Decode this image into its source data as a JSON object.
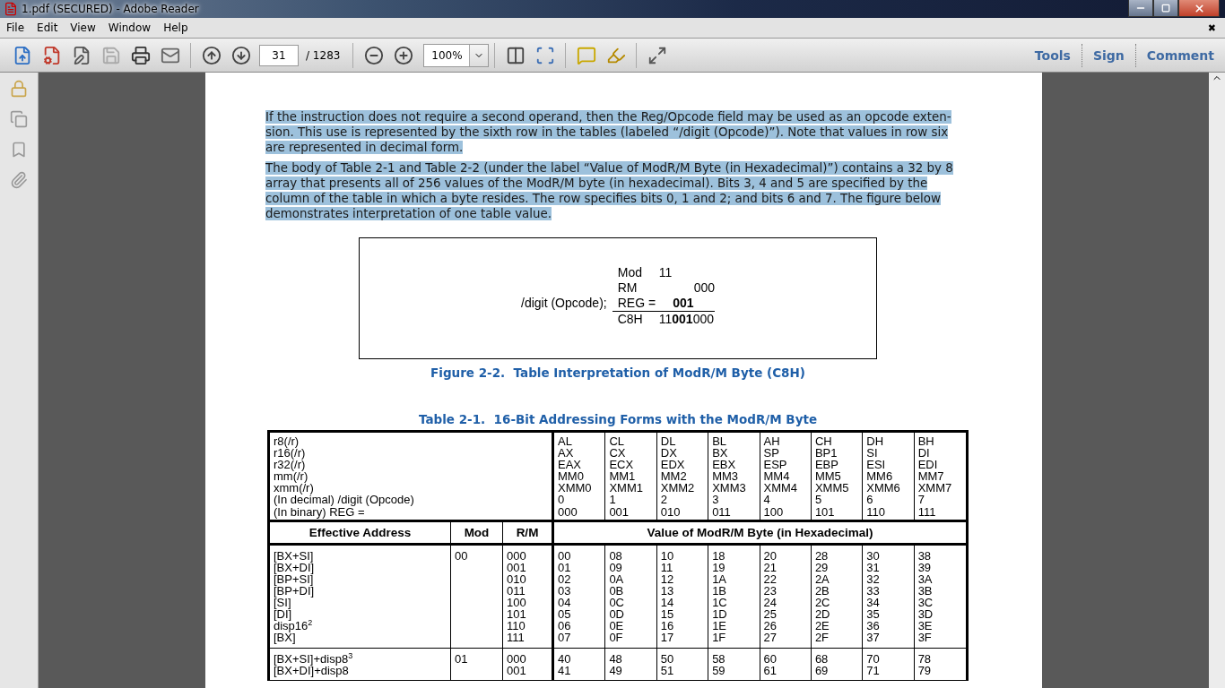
{
  "window": {
    "title": "1.pdf (SECURED) - Adobe Reader"
  },
  "menu": {
    "items": [
      "File",
      "Edit",
      "View",
      "Window",
      "Help"
    ],
    "close_glyph": "✖"
  },
  "toolbar": {
    "page_number": "31",
    "page_total": "/ 1283",
    "zoom": "100%",
    "panes": [
      "Tools",
      "Sign",
      "Comment"
    ]
  },
  "document": {
    "paragraphs": [
      {
        "highlighted": true,
        "lines": [
          "If the instruction does not require a second operand, then the Reg/Opcode field may be used as an opcode exten-",
          "sion. This use is represented by the sixth row in the tables (labeled “/digit (Opcode)”). Note that values in row six",
          "are represented in decimal form."
        ]
      },
      {
        "highlighted": true,
        "lines": [
          "The body of Table 2-1 and Table 2-2 (under the label “Value of ModR/M Byte (in Hexadecimal)”) contains a 32 by 8",
          "array that presents all of 256 values of the ModR/M byte (in hexadecimal). Bits 3, 4 and 5 are specified by the",
          "column of the table in which a byte resides. The row specifies bits 0, 1 and 2; and bits 6 and 7. The figure below",
          "demonstrates interpretation of one table value."
        ]
      }
    ],
    "figure": {
      "label": "/digit (Opcode);",
      "rows": [
        {
          "kind": "mod",
          "name": "Mod",
          "value": "11"
        },
        {
          "kind": "rm",
          "name": "RM",
          "value": "000"
        },
        {
          "kind": "reg",
          "name": "REG =",
          "value": "001"
        }
      ],
      "result": {
        "name": "C8H",
        "value": "11**001**000"
      },
      "caption": "Figure 2-2.  Table Interpretation of ModR/M Byte (C8H)"
    },
    "table": {
      "title": "Table 2-1.  16-Bit Addressing Forms with the ModR/M Byte",
      "row_labels": [
        "r8(/r)",
        "r16(/r)",
        "r32(/r)",
        "mm(/r)",
        "xmm(/r)",
        "(In decimal) /digit (Opcode)",
        "(In binary) REG ="
      ],
      "register_columns": [
        [
          "AL",
          "AX",
          "EAX",
          "MM0",
          "XMM0",
          "0",
          "000"
        ],
        [
          "CL",
          "CX",
          "ECX",
          "MM1",
          "XMM1",
          "1",
          "001"
        ],
        [
          "DL",
          "DX",
          "EDX",
          "MM2",
          "XMM2",
          "2",
          "010"
        ],
        [
          "BL",
          "BX",
          "EBX",
          "MM3",
          "XMM3",
          "3",
          "011"
        ],
        [
          "AH",
          "SP",
          "ESP",
          "MM4",
          "XMM4",
          "4",
          "100"
        ],
        [
          "CH",
          "BP1",
          "EBP",
          "MM5",
          "XMM5",
          "5",
          "101"
        ],
        [
          "DH",
          "SI",
          "ESI",
          "MM6",
          "XMM6",
          "6",
          "110"
        ],
        [
          "BH",
          "DI",
          "EDI",
          "MM7",
          "XMM7",
          "7",
          "111"
        ]
      ],
      "columns": [
        "Effective Address",
        "Mod",
        "R/M",
        "Value of ModR/M Byte (in Hexadecimal)"
      ],
      "groups": [
        {
          "addresses": [
            "[BX+SI]",
            "[BX+DI]",
            "[BP+SI]",
            "[BP+DI]",
            "[SI]",
            "[DI]",
            "disp16$^{2}$",
            "[BX]"
          ],
          "mod": "00",
          "rm": [
            "000",
            "001",
            "010",
            "011",
            "100",
            "101",
            "110",
            "111"
          ],
          "values": [
            [
              "00",
              "01",
              "02",
              "03",
              "04",
              "05",
              "06",
              "07"
            ],
            [
              "08",
              "09",
              "0A",
              "0B",
              "0C",
              "0D",
              "0E",
              "0F"
            ],
            [
              "10",
              "11",
              "12",
              "13",
              "14",
              "15",
              "16",
              "17"
            ],
            [
              "18",
              "19",
              "1A",
              "1B",
              "1C",
              "1D",
              "1E",
              "1F"
            ],
            [
              "20",
              "21",
              "22",
              "23",
              "24",
              "25",
              "26",
              "27"
            ],
            [
              "28",
              "29",
              "2A",
              "2B",
              "2C",
              "2D",
              "2E",
              "2F"
            ],
            [
              "30",
              "31",
              "32",
              "33",
              "34",
              "35",
              "36",
              "37"
            ],
            [
              "38",
              "39",
              "3A",
              "3B",
              "3C",
              "3D",
              "3E",
              "3F"
            ]
          ]
        },
        {
          "addresses": [
            "[BX+SI]+disp8$^{3}$",
            "[BX+DI]+disp8"
          ],
          "mod": "01",
          "rm": [
            "000",
            "001"
          ],
          "values": [
            [
              "40",
              "41"
            ],
            [
              "48",
              "49"
            ],
            [
              "50",
              "51"
            ],
            [
              "58",
              "59"
            ],
            [
              "60",
              "61"
            ],
            [
              "68",
              "69"
            ],
            [
              "70",
              "71"
            ],
            [
              "78",
              "79"
            ]
          ]
        }
      ]
    }
  }
}
